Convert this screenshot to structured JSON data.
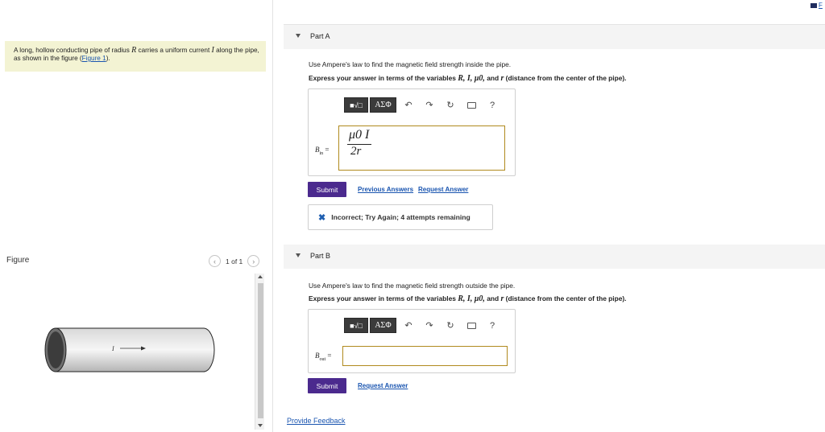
{
  "problem": {
    "text_before_R": "A long, hollow conducting pipe of radius ",
    "var_R": "R",
    "text_mid": " carries a uniform current ",
    "var_I": "I",
    "text_after": " along the pipe, as shown in the figure (",
    "figure_link": "Figure 1",
    "text_end": ")."
  },
  "figure": {
    "label": "Figure",
    "pager": "1 of 1",
    "prev_icon": "chevron-left-icon",
    "next_icon": "chevron-right-icon",
    "current_label": "I"
  },
  "corner_link": "F",
  "toolbar": {
    "template_icon": "sqrt-template-icon",
    "greek_label": "ΑΣΦ",
    "undo_icon": "undo-icon",
    "redo_icon": "redo-icon",
    "reset_icon": "reset-icon",
    "keyboard_icon": "keyboard-icon",
    "help_label": "?"
  },
  "partA": {
    "title": "Part A",
    "question": "Use Ampere's law to find the magnetic field strength inside the pipe.",
    "instruction_prefix": "Express your answer in terms of the variables ",
    "vars": "R, I, μ0,",
    "instruction_mid": " and ",
    "var_r": "r",
    "instruction_suffix": " (distance from the center of the pipe).",
    "var_label": "B",
    "var_sub": "in",
    "eq": "=",
    "answer_num": "μ0 I",
    "answer_den": "2r",
    "submit": "Submit",
    "prev_answers": "Previous Answers",
    "request_answer": "Request Answer",
    "feedback_icon": "x-icon",
    "feedback": "Incorrect; Try Again; 4 attempts remaining"
  },
  "partB": {
    "title": "Part B",
    "question": "Use Ampere's law to find the magnetic field strength outside the pipe.",
    "instruction_prefix": "Express your answer in terms of the variables ",
    "vars": "R, I, μ0,",
    "instruction_mid": " and ",
    "var_r": "r",
    "instruction_suffix": " (distance from the center of the pipe).",
    "var_label": "B",
    "var_sub": "out",
    "eq": "=",
    "answer_value": "",
    "submit": "Submit",
    "request_answer": "Request Answer"
  },
  "footer": {
    "provide_feedback": "Provide Feedback"
  },
  "colors": {
    "submit": "#4b2a8e",
    "link": "#1a55b0",
    "problem_bg": "#f3f3d3",
    "input_border": "#b08a1e"
  }
}
